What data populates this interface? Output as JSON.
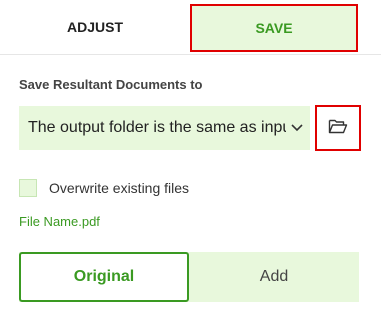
{
  "tabs": {
    "adjust_label": "ADJUST",
    "save_label": "SAVE"
  },
  "save_section": {
    "label": "Save Resultant Documents to",
    "folder_select_value": "The output folder is the same as inpu",
    "chevron_icon": "chevron-down-icon",
    "folder_button_icon": "folder-open-icon"
  },
  "options": {
    "overwrite_label": "Overwrite existing files",
    "overwrite_checked": false
  },
  "file": {
    "name": "File Name.pdf"
  },
  "mode_segment": {
    "original_label": "Original",
    "add_label": "Add",
    "selected": "Original"
  },
  "colors": {
    "accent_green": "#3a9a22",
    "light_green": "#e8f8dc",
    "highlight_red": "#e00000"
  }
}
